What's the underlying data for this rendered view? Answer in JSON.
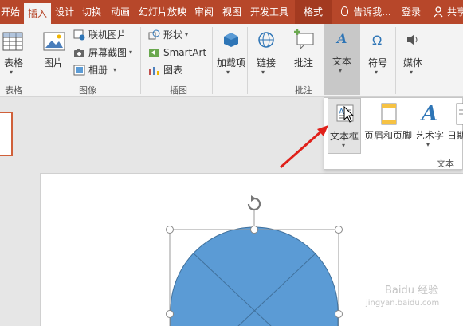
{
  "tabs": [
    "开始",
    "插入",
    "设计",
    "切换",
    "动画",
    "幻灯片放映",
    "审阅",
    "视图",
    "开发工具",
    "格式"
  ],
  "active_tab": "插入",
  "tell_me": "告诉我...",
  "login": "登录",
  "share": "共享",
  "ribbon": {
    "tables": {
      "button": "表格",
      "group": "表格"
    },
    "images": {
      "picture": "图片",
      "online_pictures": "联机图片",
      "screenshot": "屏幕截图",
      "album": "相册",
      "group": "图像"
    },
    "illustrations": {
      "shapes": "形状",
      "smartart": "SmartArt",
      "chart": "图表",
      "group": "插图"
    },
    "addins": {
      "button": "加载项"
    },
    "links": {
      "button": "链接"
    },
    "comments": {
      "button": "批注",
      "group": "批注"
    },
    "text": {
      "button": "文本"
    },
    "symbols": {
      "button": "符号"
    },
    "media": {
      "button": "媒体"
    }
  },
  "text_dropdown": {
    "items": [
      "文本框",
      "页眉和页脚",
      "艺术字",
      "日期"
    ],
    "group": "文本"
  },
  "watermark": {
    "line1": "Baidu 经验",
    "line2": "jingyan.baidu.com"
  },
  "colors": {
    "accent": "#b7472a",
    "shape_fill": "#5b9bd5",
    "arrow": "#e0201a"
  }
}
